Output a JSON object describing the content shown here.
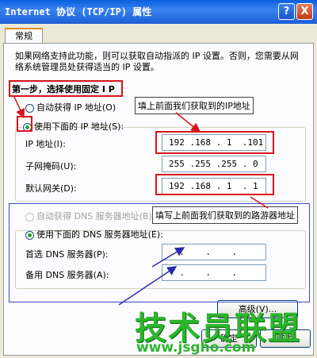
{
  "window": {
    "title": "Internet 协议 (TCP/IP) 属性",
    "help_label": "?",
    "close_label": "X"
  },
  "tabs": {
    "general": "常规"
  },
  "description": "如果网络支持此功能，则可以获取自动指派的 IP 设置。否则，您需要从网络系统管理员处获得适当的 IP 设置。",
  "ip": {
    "auto_label": "自动获得 IP 地址(O)",
    "manual_label": "使用下面的 IP 地址(S):",
    "address_label": "IP 地址(I):",
    "address_value": "192 .168 . 1  .101",
    "mask_label": "子网掩码(U):",
    "mask_value": "255 .255 .255 . 0",
    "gateway_label": "默认网关(D):",
    "gateway_value": "192 .168 . 1  . 1"
  },
  "dns": {
    "auto_label": "自动获得 DNS 服务器地址(B)",
    "manual_label": "使用下面的 DNS 服务器地址(E):",
    "preferred_label": "首选 DNS 服务器(P):",
    "preferred_value": "  .    .    .  ",
    "alternate_label": "备用 DNS 服务器(A):",
    "alternate_value": "  .    .    .  "
  },
  "buttons": {
    "advanced": "高级(V)...",
    "ok": "确定",
    "cancel": "取消"
  },
  "annotations": {
    "step1": "第一步，选择使用固定 I P",
    "fill_ip": "填上前面我们获取到的IP地址",
    "fill_gateway": "填写上前面我们获取到的路游器地址"
  },
  "watermark": {
    "text": "技术员联盟",
    "url": "www.jsgho.com"
  }
}
